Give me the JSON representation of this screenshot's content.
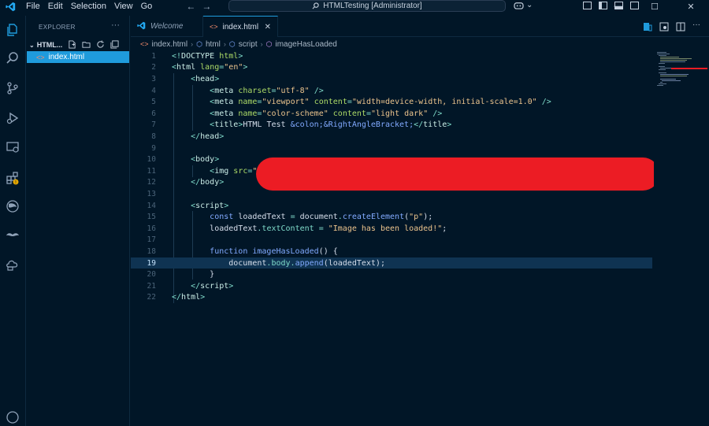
{
  "titlebar": {
    "menu": [
      "File",
      "Edit",
      "Selection",
      "View",
      "Go"
    ],
    "command_center": "HTMLTesting [Administrator]",
    "min": "—",
    "max": "☐",
    "close": "✕"
  },
  "activity": [
    "explorer-icon",
    "search-icon",
    "source-control-icon",
    "run-debug-icon",
    "remote-explorer-icon",
    "extensions-icon",
    "browser-icon",
    "mustache-icon",
    "cloud-icon",
    "account-icon"
  ],
  "sidebar": {
    "header": "EXPLORER",
    "more": "···",
    "folder": "HTML...",
    "file": "index.html"
  },
  "tabs": [
    {
      "label": "Welcome"
    },
    {
      "label": "index.html",
      "close": "✕"
    }
  ],
  "breadcrumb": [
    "index.html",
    "html",
    "script",
    "imageHasLoaded"
  ],
  "editor": {
    "current_line": 19,
    "line_numbers": [
      "1",
      "2",
      "3",
      "4",
      "5",
      "6",
      "7",
      "8",
      "9",
      "10",
      "11",
      "12",
      "13",
      "14",
      "15",
      "16",
      "17",
      "18",
      "19",
      "20",
      "21",
      "22"
    ]
  },
  "colors": {
    "background": "#011627",
    "accent": "#1f9bdc",
    "redaction": "#ec1c24"
  }
}
